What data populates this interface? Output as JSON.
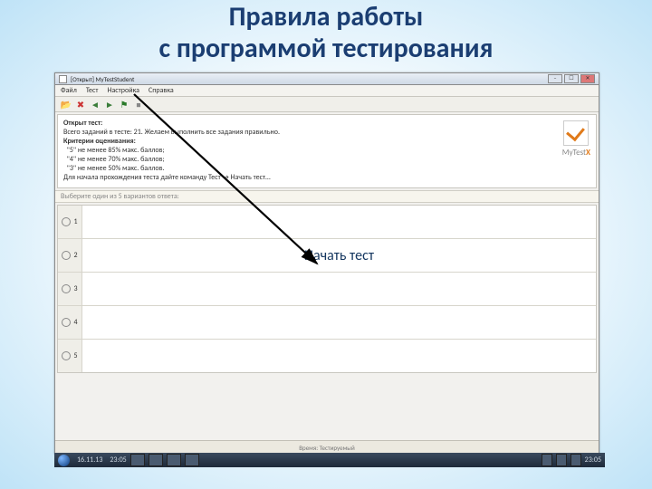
{
  "slide": {
    "title_line1": "Правила работы",
    "title_line2": "с программой тестирования",
    "annotation": "Начать тест"
  },
  "window": {
    "title": "[Открыт] MyTestStudent",
    "controls": {
      "min": "–",
      "max": "☐",
      "close": "✕"
    }
  },
  "menu": [
    "Файл",
    "Тест",
    "Настройка",
    "Справка"
  ],
  "toolbar_icons": {
    "open": {
      "glyph": "📂",
      "color": "#caa24b"
    },
    "stop": {
      "glyph": "✖",
      "color": "#c33"
    },
    "prev": {
      "glyph": "◄",
      "color": "#3a7d3a"
    },
    "next": {
      "glyph": "►",
      "color": "#3a7d3a"
    },
    "flag": {
      "glyph": "⚑",
      "color": "#2a7a2a"
    },
    "finish": {
      "glyph": "⏹",
      "color": "#888"
    }
  },
  "info": {
    "heading": "Открыт тест:",
    "line1": "Всего заданий в тесте: 21. Желаем выполнить все задания правильно.",
    "criteria_title": "Критерии оценивания:",
    "criteria": [
      "\"5\" не менее 85% макс. баллов;",
      "\"4\" не менее 70% макс. баллов;",
      "\"3\" не менее 50% макс. баллов."
    ],
    "hint": "Для начала прохождения теста дайте команду Тест → Начать тест…"
  },
  "logo": {
    "brand": "MyTest",
    "suffix": "X"
  },
  "question_strip": "Выберите один из 5 вариантов ответа:",
  "answers": [
    "1",
    "2",
    "3",
    "4",
    "5"
  ],
  "statusbar": "Время: Тестируемый",
  "taskbar": {
    "date": "16.11.13",
    "time": "23:05",
    "right_time": "23:05"
  }
}
